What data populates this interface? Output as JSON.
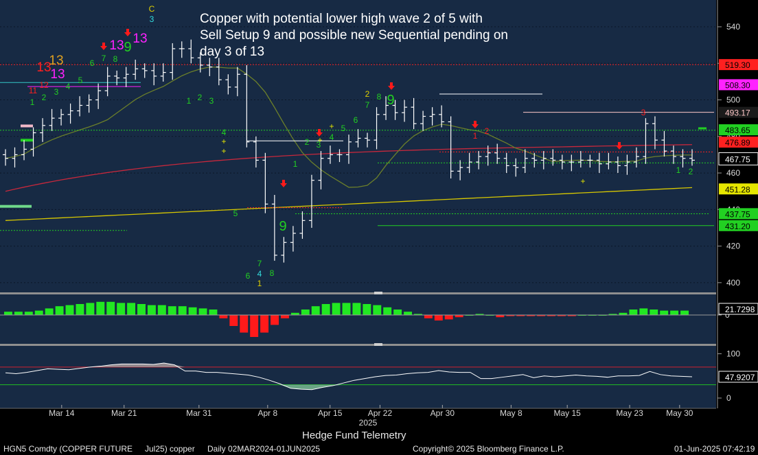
{
  "annotation": {
    "lines": [
      "Copper with potential lower high wave 2 of 5 with",
      "Sell Setup 9 and possible new Sequential pending on",
      "day 3 of 13"
    ]
  },
  "footer": {
    "title": "Hedge Fund Telemetry",
    "security": "HGN5 Comdty (COPPER FUTURE",
    "contract": "Jul25) copper",
    "period": "Daily 02MAR2024-01JUN2025",
    "copyright": "Copyright© 2025 Bloomberg Finance L.P.",
    "timestamp": "01-Jun-2025 07:42:19"
  },
  "colors": {
    "background": "#172a44",
    "up_bar": "#ffffff",
    "seq_green": "#22d022",
    "seq_red": "#ff2020",
    "ma_red": "#c8283c",
    "ma_olive": "#6b7f2a",
    "ma_yellow": "#d8c800",
    "hist_pos": "#22e822",
    "hist_neg": "#ff1a1a"
  },
  "chart_data": [
    {
      "type": "candlestick",
      "name": "price",
      "x_ticks": [
        "Mar 14",
        "Mar 21",
        "Mar 31",
        "Apr 8",
        "Apr 15",
        "Apr 22",
        "Apr 30",
        "May 8",
        "May 15",
        "May 23",
        "May 30"
      ],
      "year_label": "2025",
      "ylim": [
        395,
        552
      ],
      "y_ticks": [
        400,
        420,
        440,
        460,
        480,
        500,
        520,
        540
      ],
      "y_scale": "linear",
      "y_axis_side": "right",
      "closes": [
        468,
        470,
        473,
        482,
        486,
        490,
        492,
        494,
        497,
        500,
        505,
        513,
        512,
        514,
        517,
        516,
        513,
        515,
        528,
        528,
        523,
        519,
        518,
        511,
        507,
        514,
        477,
        467,
        443,
        415,
        422,
        427,
        434,
        456,
        468,
        470,
        470,
        477,
        479,
        478,
        492,
        497,
        493,
        496,
        487,
        491,
        492,
        488,
        461,
        463,
        466,
        469,
        471,
        468,
        464,
        463,
        468,
        467,
        468,
        467,
        466,
        466,
        467,
        467,
        465,
        466,
        464,
        466,
        469,
        487,
        478,
        472,
        469,
        468,
        467
      ],
      "price_labels": [
        {
          "text": "519.30",
          "color": "#ff2020",
          "value": 519.3
        },
        {
          "text": "508.30",
          "color": "#ff22ff",
          "value": 508.3
        },
        {
          "text": "493.17",
          "color": "#ffc8c8",
          "value": 493.17
        },
        {
          "text": "483.65",
          "color": "#22d022",
          "value": 483.65
        },
        {
          "text": "476.89",
          "color": "#ff2020",
          "value": 476.89
        },
        {
          "text": "467.75",
          "color": "#ffffff",
          "value": 467.75
        },
        {
          "text": "451.28",
          "color": "#e6e600",
          "value": 451.28
        },
        {
          "text": "437.75",
          "color": "#22d022",
          "value": 437.75
        },
        {
          "text": "431.20",
          "color": "#22d022",
          "value": 431.2
        }
      ],
      "sequential_counts": [
        {
          "text": "11",
          "color": "#ff2020"
        },
        {
          "text": "12",
          "color": "#ff2020"
        },
        {
          "text": "13",
          "color": "#ff22ff"
        },
        {
          "text": "13",
          "color": "#ff2020"
        },
        {
          "text": "13",
          "color": "#e0a020"
        },
        {
          "text": "13",
          "color": "#ff22ff"
        },
        {
          "text": "13",
          "color": "#ff22ff"
        },
        {
          "text": "1",
          "color": "#22d022"
        },
        {
          "text": "2",
          "color": "#22d022"
        },
        {
          "text": "3",
          "color": "#22d022"
        },
        {
          "text": "4",
          "color": "#22d022"
        },
        {
          "text": "5",
          "color": "#22d022"
        },
        {
          "text": "6",
          "color": "#22d022"
        },
        {
          "text": "7",
          "color": "#22d022"
        },
        {
          "text": "8",
          "color": "#22d022"
        },
        {
          "text": "9",
          "color": "#22d022"
        },
        {
          "text": "C",
          "color": "#e0d000"
        },
        {
          "text": "3",
          "color": "#33dddd"
        },
        {
          "text": "1",
          "color": "#22d022"
        },
        {
          "text": "2",
          "color": "#22d022"
        },
        {
          "text": "3",
          "color": "#22d022"
        },
        {
          "text": "4",
          "color": "#22d022"
        },
        {
          "text": "5",
          "color": "#22d022"
        },
        {
          "text": "6",
          "color": "#22d022"
        },
        {
          "text": "7",
          "color": "#22d022"
        },
        {
          "text": "4",
          "color": "#33dddd"
        },
        {
          "text": "1",
          "color": "#e0d000"
        },
        {
          "text": "8",
          "color": "#22d022"
        },
        {
          "text": "9",
          "color": "#22d022"
        },
        {
          "text": "1",
          "color": "#22d022"
        },
        {
          "text": "2",
          "color": "#22d022"
        },
        {
          "text": "3",
          "color": "#22d022"
        },
        {
          "text": "4",
          "color": "#22d022"
        },
        {
          "text": "5",
          "color": "#22d022"
        },
        {
          "text": "6",
          "color": "#22d022"
        },
        {
          "text": "7",
          "color": "#22d022"
        },
        {
          "text": "2",
          "color": "#e0d000"
        },
        {
          "text": "8",
          "color": "#22d022"
        },
        {
          "text": "9",
          "color": "#22d022"
        },
        {
          "text": "1",
          "color": "#ff2020"
        },
        {
          "text": "2",
          "color": "#ff2020"
        },
        {
          "text": "3",
          "color": "#ff2020"
        },
        {
          "text": "1",
          "color": "#22d022"
        },
        {
          "text": "2",
          "color": "#22d022"
        }
      ]
    },
    {
      "type": "bar",
      "name": "momentum histogram",
      "ylim": [
        -25,
        16
      ],
      "y_ticks": [
        0
      ],
      "last_value_label": "21.7298",
      "values": [
        3,
        3,
        3,
        4,
        6,
        8,
        9,
        10,
        11,
        12,
        12,
        11,
        11,
        10,
        9,
        9,
        8,
        8,
        7,
        6,
        5,
        -3,
        -10,
        -16,
        -20,
        -16,
        -9,
        -3,
        2,
        5,
        8,
        10,
        11,
        11,
        11,
        10,
        9,
        7,
        5,
        3,
        1,
        -3,
        -5,
        -4,
        -2,
        0,
        1,
        0,
        -2,
        -1,
        -1,
        -1,
        -1,
        -1,
        -1,
        -1,
        0,
        0,
        0,
        1,
        2,
        5,
        6,
        5,
        4,
        4,
        4
      ]
    },
    {
      "type": "line",
      "name": "oscillator",
      "ylim": [
        -5,
        105
      ],
      "y_ticks": [
        0,
        100
      ],
      "levels": [
        70,
        30
      ],
      "last_value_label": "47.9207",
      "values": [
        57,
        55,
        58,
        62,
        66,
        65,
        64,
        67,
        70,
        72,
        75,
        77,
        77,
        77,
        76,
        79,
        75,
        61,
        61,
        58,
        58,
        56,
        54,
        52,
        47,
        40,
        32,
        22,
        20,
        19,
        24,
        28,
        34,
        40,
        44,
        48,
        51,
        52,
        55,
        57,
        58,
        62,
        59,
        58,
        58,
        44,
        44,
        47,
        50,
        53,
        46,
        50,
        48,
        50,
        52,
        50,
        49,
        47,
        50,
        50,
        51,
        60,
        53,
        50,
        49,
        48
      ]
    }
  ]
}
